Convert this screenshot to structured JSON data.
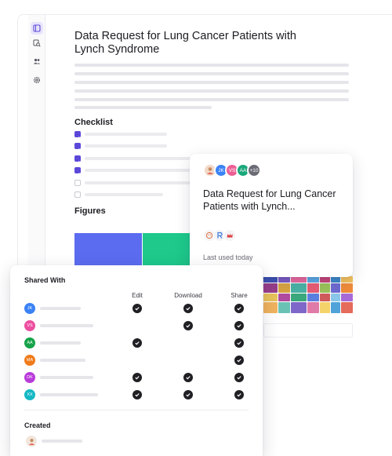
{
  "document": {
    "title": "Data Request for Lung Cancer Patients with Lynch Syndrome",
    "checklist_title": "Checklist",
    "figures_title": "Figures",
    "checklist": [
      {
        "checked": true
      },
      {
        "checked": true
      },
      {
        "checked": true
      },
      {
        "checked": true
      },
      {
        "checked": false
      },
      {
        "checked": false
      }
    ]
  },
  "sidebar": {
    "icons": [
      "document-icon",
      "search-document-icon",
      "people-icon",
      "settings-icon"
    ],
    "active": "document-icon"
  },
  "recent_card": {
    "title": "Data Request for Lung Cancer Patients with Lynch...",
    "meta": "Last used today",
    "avatars": [
      {
        "initials": "",
        "color": "#f2d9c7",
        "icon": "person-photo-icon"
      },
      {
        "initials": "JK",
        "color": "#3b82f6"
      },
      {
        "initials": "VS",
        "color": "#ec5f93"
      },
      {
        "initials": "AA",
        "color": "#1aa87a"
      }
    ],
    "more_count": "+10"
  },
  "share_card": {
    "title": "Shared With",
    "columns": [
      "Edit",
      "Download",
      "Share"
    ],
    "rows": [
      {
        "initials": "JK",
        "color": "#3b82f6",
        "edit": true,
        "download": true,
        "share": true
      },
      {
        "initials": "VS",
        "color": "#ec4fa0",
        "edit": false,
        "download": true,
        "share": true
      },
      {
        "initials": "AA",
        "color": "#16a34a",
        "edit": true,
        "download": false,
        "share": true
      },
      {
        "initials": "MA",
        "color": "#f07a1a",
        "edit": false,
        "download": false,
        "share": true
      },
      {
        "initials": "DK",
        "color": "#b83bd9",
        "edit": true,
        "download": true,
        "share": true
      },
      {
        "initials": "XX",
        "color": "#14b8c4",
        "edit": true,
        "download": true,
        "share": true
      }
    ],
    "created_title": "Created"
  },
  "colors": {
    "accent": "#5b48d9",
    "figure_blue": "#5b6cf0",
    "figure_green": "#1ec98b"
  }
}
